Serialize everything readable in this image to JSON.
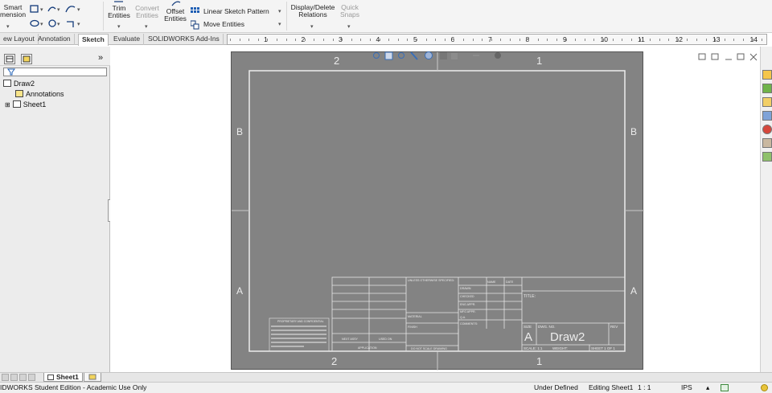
{
  "ribbon": {
    "smart_dimension": [
      "Smart",
      "mension"
    ],
    "trim_entities": [
      "Trim",
      "Entities"
    ],
    "convert_entities": [
      "Convert",
      "Entities"
    ],
    "offset_entities": [
      "Offset",
      "Entities"
    ],
    "linear_sketch_pattern": "Linear Sketch Pattern",
    "move_entities": "Move Entities",
    "display_delete_relations": [
      "Display/Delete",
      "Relations"
    ],
    "quick_snaps": [
      "Quick",
      "Snaps"
    ]
  },
  "tabs": [
    "ew Layout",
    "Annotation",
    "Sketch",
    "Evaluate",
    "SOLIDWORKS Add-Ins"
  ],
  "active_tab": "Sketch",
  "ruler": {
    "numbers": [
      "1",
      "2",
      "3",
      "4",
      "5",
      "6",
      "7",
      "8",
      "9",
      "10",
      "11",
      "12",
      "13",
      "14"
    ]
  },
  "left_panel": {
    "collapse_glyph": "»",
    "tree": {
      "root": "Draw2",
      "children": [
        "Annotations",
        "Sheet1"
      ]
    }
  },
  "drawing": {
    "zone_top": [
      "2",
      "1"
    ],
    "zone_bottom": [
      "2",
      "1"
    ],
    "zone_left": [
      "B",
      "A"
    ],
    "zone_right": [
      "B",
      "A"
    ],
    "title_block": {
      "size": "A",
      "dwg_no_label": "DWG. NO.",
      "dwg_no": "Draw2",
      "rev_label": "REV",
      "size_label": "SIZE",
      "scale": "SCALE: 1:1",
      "weight": "WEIGHT:",
      "sheet": "SHEET 1 OF 1",
      "title_label": "TITLE:",
      "name": "NAME",
      "date": "DATE",
      "drawn": "DRAWN",
      "checked": "CHECKED",
      "eng_appr": "ENG APPR.",
      "mfg_appr": "MFG APPR.",
      "qa": "Q.A.",
      "comments": "COMMENTS:",
      "finish": "FINISH",
      "material": "MATERIAL",
      "next_assy": "NEXT ASSY",
      "used_on": "USED ON",
      "application": "APPLICATION",
      "do_not_scale": "DO NOT SCALE DRAWING",
      "dims_note": "UNLESS OTHERWISE SPECIFIED:",
      "proprietary": "PROPRIETARY AND CONFIDENTIAL"
    }
  },
  "sheet_tab": "Sheet1",
  "status": {
    "edition": "IDWORKS Student Edition - Academic Use Only",
    "defined": "Under Defined",
    "editing": "Editing Sheet1",
    "scale": "1 : 1",
    "units": "IPS"
  },
  "colors": {
    "sheet_bg": "#838383",
    "sheet_border": "#e8e8e8",
    "accent": "#1f5fb4"
  }
}
